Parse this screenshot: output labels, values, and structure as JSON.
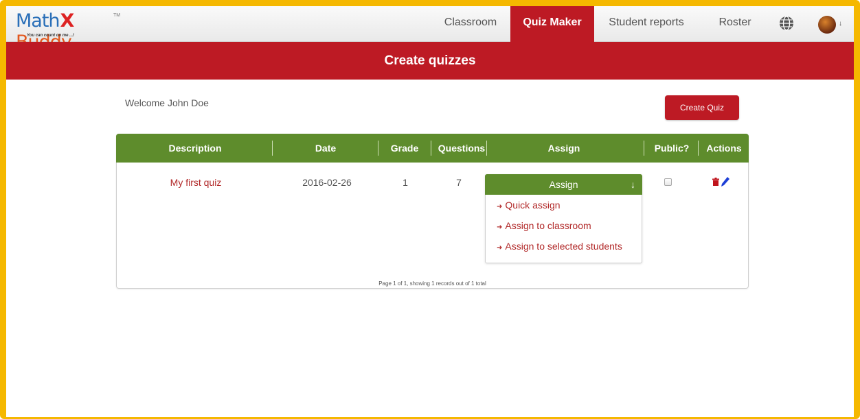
{
  "app": {
    "logo": {
      "part1": "Math",
      "part2": "Buddy",
      "tm": "TM",
      "tagline": "You can count on me ...!"
    }
  },
  "nav": {
    "items": [
      {
        "label": "Classroom",
        "active": false
      },
      {
        "label": "Quiz Maker",
        "active": true
      },
      {
        "label": "Student reports",
        "active": false
      },
      {
        "label": "Roster",
        "active": false
      }
    ],
    "globe_icon": "globe-icon",
    "avatar_icon": "user-avatar",
    "caret": "↓"
  },
  "banner": {
    "title": "Create quizzes"
  },
  "welcome": {
    "text": "Welcome John Doe"
  },
  "create_button": {
    "label": "Create Quiz"
  },
  "table": {
    "columns": [
      "Description",
      "Date",
      "Grade",
      "Questions",
      "Assign",
      "Public?",
      "Actions"
    ],
    "rows": [
      {
        "description": "My first quiz",
        "date": "2016-02-26",
        "grade": "1",
        "questions": "7",
        "public": false
      }
    ],
    "assign_menu": {
      "label": "Assign",
      "options": [
        "Quick assign",
        "Assign to classroom",
        "Assign to selected students"
      ]
    },
    "pager": "Page 1 of 1, showing 1 records out of 1 total"
  },
  "colors": {
    "brand_red": "#bd1a24",
    "header_green": "#5e8c2c",
    "frame_yellow": "#f5b800",
    "link_red": "#b22a2a"
  }
}
